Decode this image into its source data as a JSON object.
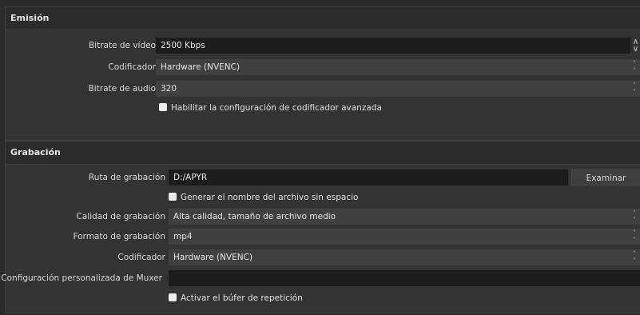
{
  "emision": {
    "title": "Emisión",
    "video_bitrate": {
      "label": "Bitrate de vídeo",
      "value": "2500 Kbps"
    },
    "encoder": {
      "label": "Codificador",
      "value": "Hardware (NVENC)"
    },
    "audio_bitrate": {
      "label": "Bitrate de audio",
      "value": "320"
    },
    "advanced_checkbox": {
      "label": "Habilitar la configuración de codificador avanzada",
      "checked": false
    }
  },
  "grabacion": {
    "title": "Grabación",
    "path": {
      "label": "Ruta de grabación",
      "value": "D:/APYR",
      "browse_label": "Examinar"
    },
    "no_space_checkbox": {
      "label": "Generar el nombre del archivo sin espacio",
      "checked": false
    },
    "quality": {
      "label": "Calidad de grabación",
      "value": "Alta calidad, tamaño de archivo medio"
    },
    "format": {
      "label": "Formato de grabación",
      "value": "mp4"
    },
    "encoder": {
      "label": "Codificador",
      "value": "Hardware (NVENC)"
    },
    "muxer": {
      "label": "Configuración personalizada de Muxer",
      "value": ""
    },
    "replay_checkbox": {
      "label": "Activar el búfer de repetición",
      "checked": false
    }
  },
  "icons": {
    "spin_up": "▲",
    "spin_down": "▼",
    "combo_up": "⌃",
    "combo_down": "⌄"
  },
  "colors": {
    "background": "#2b2b2b",
    "panel": "#333333",
    "input_dark": "#1c1c1c",
    "combo": "#404040"
  }
}
